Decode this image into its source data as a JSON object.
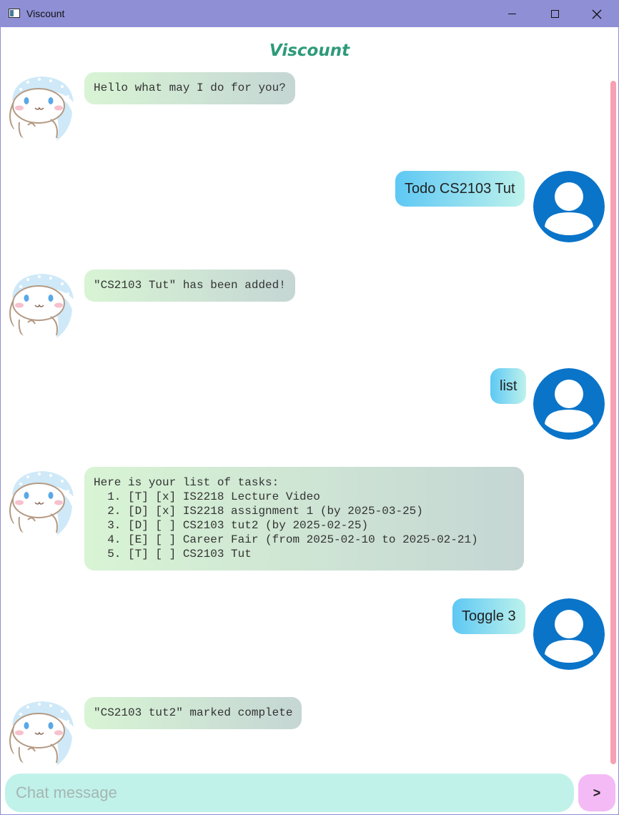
{
  "window": {
    "title": "Viscount",
    "controls": [
      "minimize-icon",
      "maximize-icon",
      "close-icon"
    ]
  },
  "header": {
    "title": "Viscount"
  },
  "messages": [
    {
      "sender": "bot",
      "text": "Hello what may I do for you?"
    },
    {
      "sender": "user",
      "text": "Todo CS2103 Tut"
    },
    {
      "sender": "bot",
      "text": "\"CS2103 Tut\" has been added!"
    },
    {
      "sender": "user",
      "text": "list"
    },
    {
      "sender": "bot",
      "text": "Here is your list of tasks:\n  1. [T] [x] IS2218 Lecture Video\n  2. [D] [x] IS2218 assignment 1 (by 2025-03-25)\n  3. [D] [ ] CS2103 tut2 (by 2025-02-25)\n  4. [E] [ ] Career Fair (from 2025-02-10 to 2025-02-21)\n  5. [T] [ ] CS2103 Tut"
    },
    {
      "sender": "user",
      "text": "Toggle 3"
    },
    {
      "sender": "bot",
      "text": "\"CS2103 tut2\" marked complete"
    }
  ],
  "input": {
    "placeholder": "Chat message",
    "value": ""
  },
  "send_button": {
    "label": ">"
  },
  "colors": {
    "title_bar": "#8f8fd6",
    "header_title": "#2e9a7a",
    "user_avatar": "#0a74c9",
    "scrollbar": "#f7a0b4",
    "input_bg": "#c0f2ea",
    "send_bg": "#f4baf5"
  }
}
